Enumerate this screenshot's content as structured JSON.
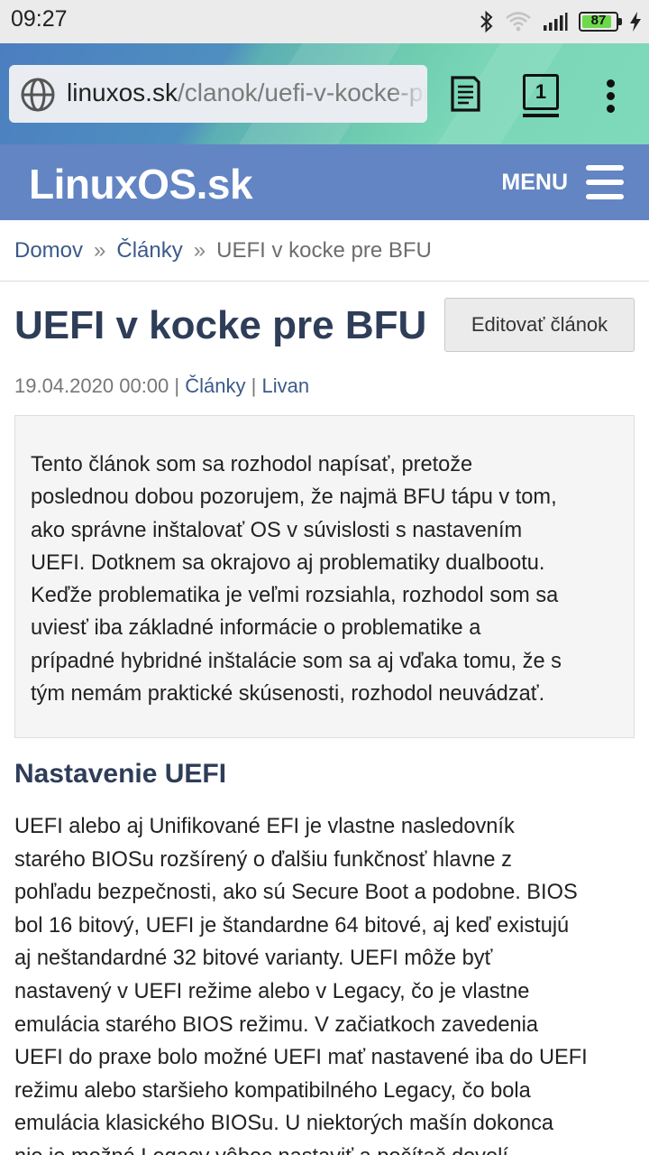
{
  "status_bar": {
    "time": "09:27",
    "battery_level": "87",
    "icons": [
      "bluetooth-icon",
      "wifi-icon",
      "signal-icon",
      "battery-icon",
      "charging-icon"
    ]
  },
  "browser": {
    "url_domain": "linuxos.sk",
    "url_path": "/clanok/uefi-v-kocke-pre-bfu/",
    "tab_count": "1"
  },
  "site": {
    "logo": "LinuxOS.sk",
    "menu_label": "MENU"
  },
  "breadcrumb": {
    "home": "Domov",
    "section": "Články",
    "current": "UEFI v kocke pre BFU",
    "separator": "»"
  },
  "article": {
    "title": "UEFI v kocke pre BFU",
    "edit_label": "Editovať článok",
    "date": "19.04.2020 00:00",
    "category": "Články",
    "author": "Livan",
    "meta_sep": "|",
    "perex_lines": [
      "Tento článok som sa rozhodol napísať, pretože",
      "poslednou dobou pozorujem, že najmä BFU tápu v tom,",
      "ako správne inštalovať OS v súvislosti s nastavením",
      "UEFI. Dotknem sa okrajovo aj problematiky dualbootu.",
      "Keďže problematika je veľmi rozsiahla, rozhodol som sa",
      "uviesť iba základné informácie o problematike a",
      "prípadné hybridné inštalácie som sa aj vďaka tomu, že s",
      "tým nemám praktické skúsenosti, rozhodol neuvádzať."
    ],
    "section_title": "Nastavenie UEFI",
    "body_lines": [
      "UEFI alebo aj Unifikované EFI je vlastne nasledovník",
      "starého BIOSu rozšírený o ďalšiu funkčnosť hlavne z",
      "pohľadu bezpečnosti, ako sú Secure Boot a podobne. BIOS",
      "bol 16 bitový, UEFI je štandardne 64 bitové, aj keď existujú",
      "aj neštandardné 32 bitové varianty. UEFI môže byť",
      "nastavený v UEFI režime alebo v Legacy, čo je vlastne",
      "emulácia starého BIOS režimu. V začiatkoch zavedenia",
      "UEFI do praxe bolo možné UEFI mať nastavené iba do UEFI",
      "režimu alebo staršieho kompatibilného Legacy, čo bola",
      "emulácia klasického BIOSu. U niektorých mašín dokonca",
      "nie je možné Legacy vôbec nastaviť a počítač dovolí"
    ]
  }
}
